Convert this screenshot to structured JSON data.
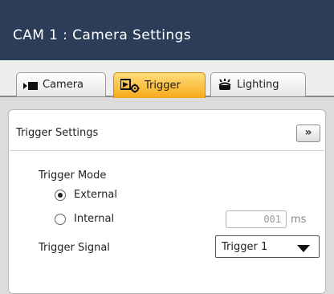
{
  "window": {
    "title": "CAM 1 : Camera Settings"
  },
  "tabs": [
    {
      "label": "Camera",
      "icon": "camera-icon",
      "active": false
    },
    {
      "label": "Trigger",
      "icon": "trigger-gear-icon",
      "active": true
    },
    {
      "label": "Lighting",
      "icon": "lighting-icon",
      "active": false
    }
  ],
  "panel": {
    "title": "Trigger Settings",
    "expand_label": "»",
    "trigger_mode": {
      "label": "Trigger Mode",
      "options": [
        {
          "label": "External",
          "checked": true
        },
        {
          "label": "Internal",
          "checked": false
        }
      ]
    },
    "interval": {
      "value": "001",
      "unit": "ms"
    },
    "trigger_signal": {
      "label": "Trigger Signal",
      "value": "Trigger 1"
    }
  },
  "colors": {
    "titlebar": "#2c3d59",
    "active_tab": "#f7a91a",
    "panel_background": "#ffffff"
  }
}
